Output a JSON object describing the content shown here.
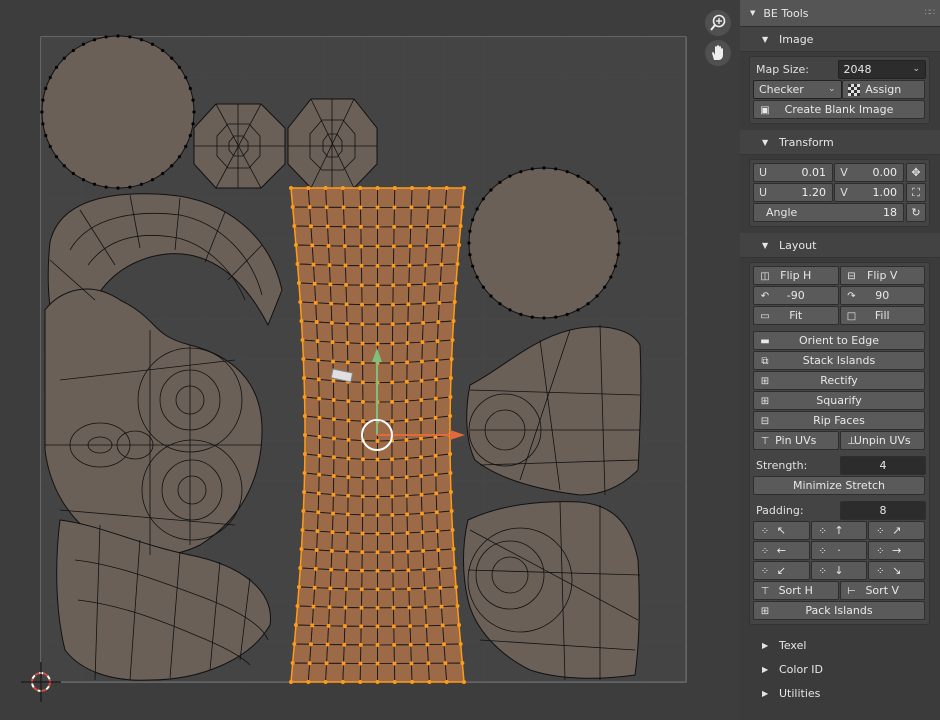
{
  "panel": {
    "title": "BE Tools",
    "image": {
      "header": "Image",
      "map_size_label": "Map Size:",
      "map_size_value": "2048",
      "checker_value": "Checker",
      "assign_label": "Assign",
      "create_blank_label": "Create Blank Image"
    },
    "transform": {
      "header": "Transform",
      "row1": {
        "u_key": "U",
        "u_val": "0.01",
        "v_key": "V",
        "v_val": "0.00"
      },
      "row2": {
        "u_key": "U",
        "u_val": "1.20",
        "v_key": "V",
        "v_val": "1.00"
      },
      "angle_label": "Angle",
      "angle_value": "18"
    },
    "layout": {
      "header": "Layout",
      "flip_h": "Flip H",
      "flip_v": "Flip V",
      "rot_neg": "-90",
      "rot_pos": "90",
      "fit": "Fit",
      "fill": "Fill",
      "orient_to_edge": "Orient to Edge",
      "stack_islands": "Stack Islands",
      "rectify": "Rectify",
      "squarify": "Squarify",
      "rip_faces": "Rip Faces",
      "pin_uvs": "Pin UVs",
      "unpin_uvs": "Unpin UVs",
      "strength_label": "Strength:",
      "strength_value": "4",
      "minimize_stretch": "Minimize Stretch",
      "padding_label": "Padding:",
      "padding_value": "8",
      "align_arrows": [
        "↖",
        "↑",
        "↗",
        "←",
        "·",
        "→",
        "↙",
        "↓",
        "↘"
      ],
      "sort_h": "Sort H",
      "sort_v": "Sort V",
      "pack_islands": "Pack Islands"
    },
    "collapsed": [
      "Texel",
      "Color ID",
      "Utilities"
    ]
  },
  "colors": {
    "selected_face": "#9c6a47",
    "selected_vertex": "#ff9b1a",
    "island_face": "#6b6058",
    "background": "#3d3d3d"
  },
  "icons": [
    "zoom-icon",
    "hand-icon",
    "cursor-icon",
    "move-gizmo-icon"
  ]
}
